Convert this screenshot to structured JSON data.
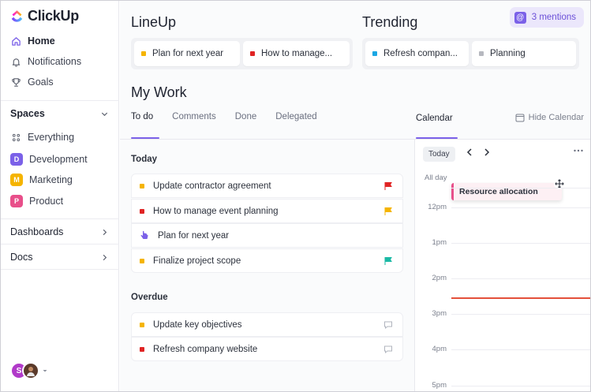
{
  "sidebar": {
    "brand": "ClickUp",
    "nav": [
      {
        "label": "Home",
        "icon": "home-icon"
      },
      {
        "label": "Notifications",
        "icon": "bell-icon"
      },
      {
        "label": "Goals",
        "icon": "trophy-icon"
      }
    ],
    "spaces_label": "Spaces",
    "spaces": [
      {
        "label": "Everything",
        "icon": "grid-icon"
      },
      {
        "label": "Development",
        "badge": "D",
        "color": "#7b61e8"
      },
      {
        "label": "Marketing",
        "badge": "M",
        "color": "#f5b400"
      },
      {
        "label": "Product",
        "badge": "P",
        "color": "#e84f8a"
      }
    ],
    "dashboards_label": "Dashboards",
    "docs_label": "Docs",
    "avatar_initial": "S"
  },
  "lineup": {
    "title": "LineUp",
    "items": [
      {
        "label": "Plan for next year",
        "color": "#f5b400"
      },
      {
        "label": "How to manage...",
        "color": "#e02424"
      }
    ]
  },
  "trending": {
    "title": "Trending",
    "items": [
      {
        "label": "Refresh compan...",
        "color": "#1aa7e4"
      },
      {
        "label": "Planning",
        "color": "#b6b8bf"
      }
    ]
  },
  "mentions": {
    "label": "3 mentions",
    "symbol": "@"
  },
  "mywork": {
    "title": "My Work",
    "tabs": [
      "To do",
      "Comments",
      "Done",
      "Delegated"
    ],
    "active_tab": "To do",
    "today_label": "Today",
    "today": [
      {
        "label": "Update contractor agreement",
        "color": "#f5b400",
        "flag": "red-flag-icon",
        "flag_color": "#e02424"
      },
      {
        "label": "How to manage event planning",
        "color": "#e02424",
        "flag": "yellow-flag-icon",
        "flag_color": "#f5b400"
      },
      {
        "label": "Plan for next year",
        "color": "#7b61e8",
        "flag": "",
        "flag_color": ""
      },
      {
        "label": "Finalize project scope",
        "color": "#f5b400",
        "flag": "teal-flag-icon",
        "flag_color": "#1bb9a5"
      }
    ],
    "overdue_label": "Overdue",
    "overdue": [
      {
        "label": "Update key objectives",
        "color": "#f5b400",
        "flag": "comment-icon"
      },
      {
        "label": "Refresh company website",
        "color": "#e02424",
        "flag": "comment-icon"
      }
    ]
  },
  "calendar": {
    "title": "Calendar",
    "hide_label": "Hide Calendar",
    "today_btn": "Today",
    "allday_label": "All day",
    "event": "Resource allocation",
    "hours": [
      "12pm",
      "1pm",
      "2pm",
      "3pm",
      "4pm",
      "5pm"
    ]
  }
}
